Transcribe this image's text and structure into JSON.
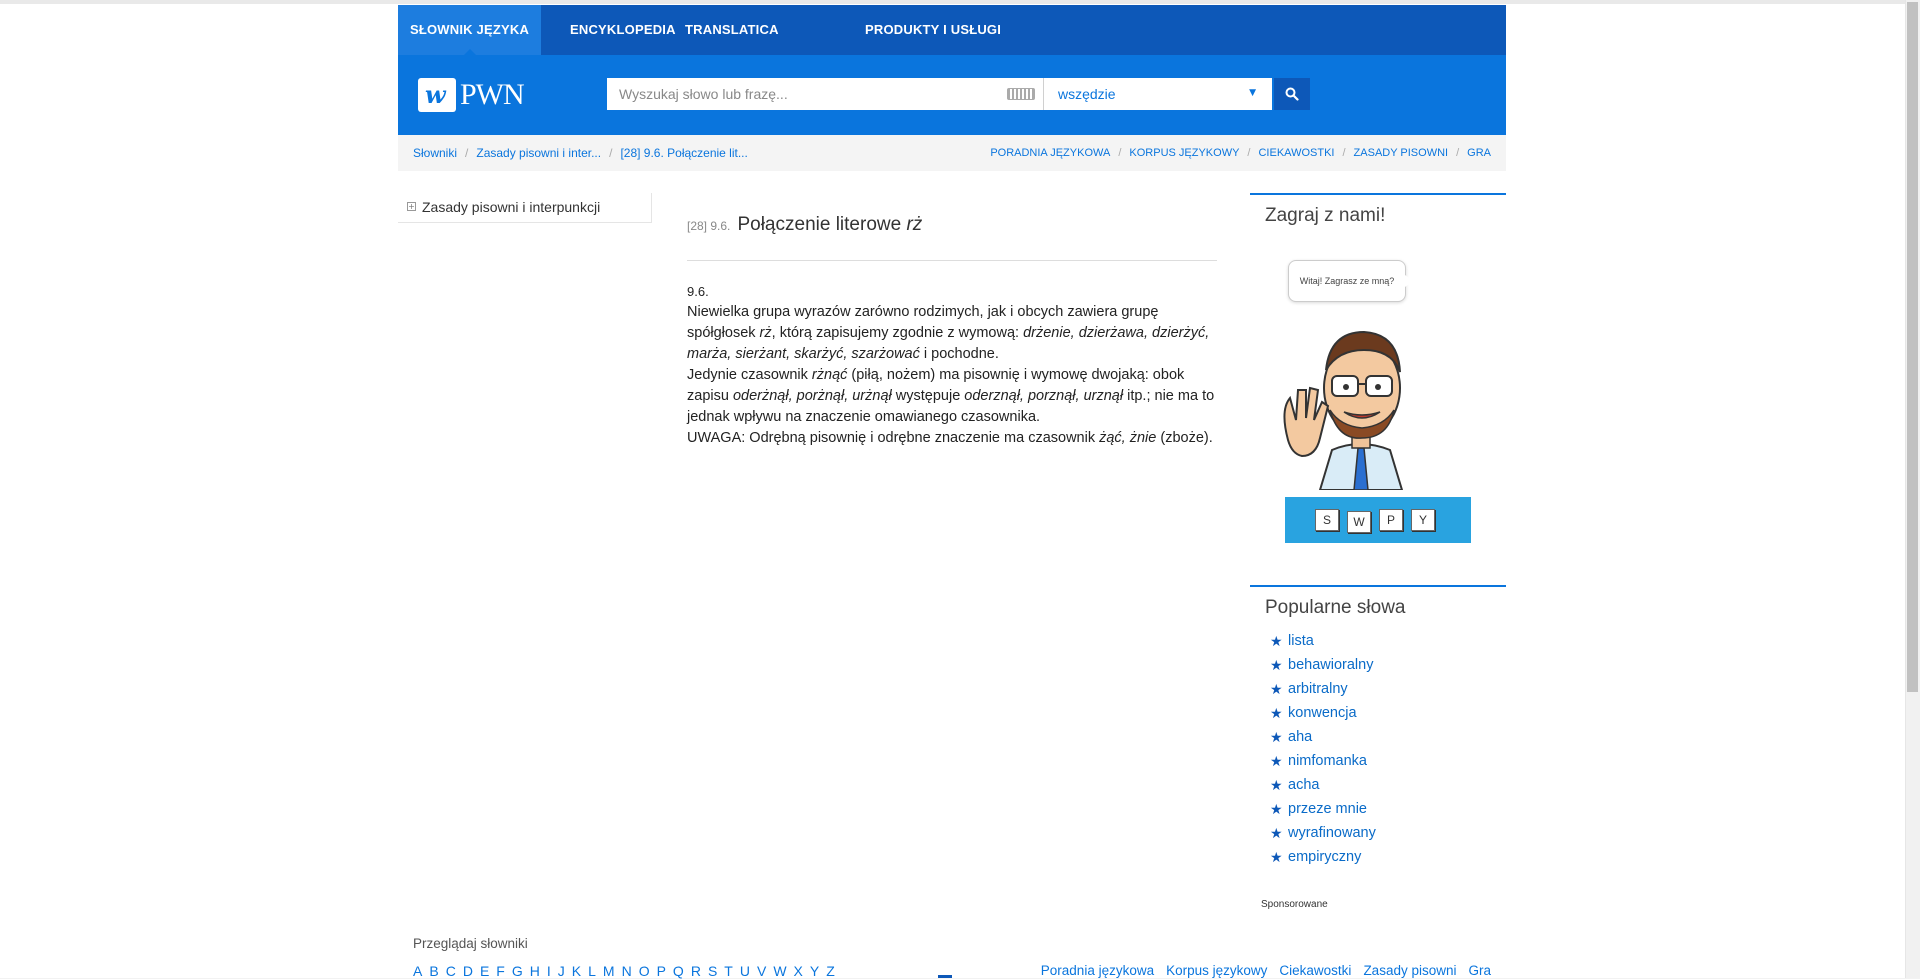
{
  "nav": {
    "items": [
      "SŁOWNIK JĘZYKA POLSKIEGO",
      "ENCYKLOPEDIA",
      "TRANSLATICA",
      "PRODUKTY I USŁUGI"
    ]
  },
  "header": {
    "logo_text": "PWN",
    "search_placeholder": "Wyszukaj słowo lub frazę...",
    "scope_value": "wszędzie"
  },
  "breadcrumb": {
    "items": [
      "Słowniki",
      "Zasady pisowni i inter...",
      "[28] 9.6. Połączenie lit..."
    ]
  },
  "sublinks": [
    "PORADNIA JĘZYKOWA",
    "KORPUS JĘZYKOWY",
    "CIEKAWOSTKI",
    "ZASADY PISOWNI",
    "GRA"
  ],
  "tree": {
    "label": "Zasady pisowni i interpunkcji",
    "toggle": "+"
  },
  "article": {
    "number": "[28] 9.6.",
    "title_main": "Połączenie literowe ",
    "title_italic": "rż",
    "section": "9.6.",
    "p1_a": "Niewielka grupa wyrazów zarówno rodzimych, jak i obcych zawiera grupę spółgłosek ",
    "p1_b": "rż",
    "p1_c": ", którą zapisujemy zgodnie z wymową: ",
    "p1_d": "drżenie, dzierżawa, dzierżyć, marża, sierżant, skarżyć, szarżować",
    "p1_e": " i pochodne.",
    "p2_a": "Jedynie czasownik ",
    "p2_b": "rżnąć",
    "p2_c": " (piłą, nożem) ma pisownię i wymowę dwojaką: obok zapisu ",
    "p2_d": "oderżnął, porżnął, urżnął",
    "p2_e": " występuje ",
    "p2_f": "oderznął, porznął, urznął",
    "p2_g": " itp.; nie ma to jednak wpływu na znaczenie omawianego czasownika.",
    "p3_a": "UWAGA: Odrębną pisownię i odrębne znaczenie ma czasownik ",
    "p3_b": "żąć, żnie",
    "p3_c": " (zboże)."
  },
  "game": {
    "title": "Zagraj z nami!",
    "bubble": "Witaj! Zagrasz ze mną?",
    "tiles": [
      "S",
      "W",
      "P",
      "Y"
    ]
  },
  "popular": {
    "title": "Popularne słowa",
    "items": [
      "lista",
      "behawioralny",
      "arbitralny",
      "konwencja",
      "aha",
      "nimfomanka",
      "acha",
      "przeze mnie",
      "wyrafinowany",
      "empiryczny"
    ]
  },
  "sponsored": "Sponsorowane",
  "footer": {
    "browse_label": "Przeglądaj słowniki",
    "letters": [
      "A",
      "B",
      "C",
      "D",
      "E",
      "F",
      "G",
      "H",
      "I",
      "J",
      "K",
      "L",
      "M",
      "N",
      "O",
      "P",
      "Q",
      "R",
      "S",
      "T",
      "U",
      "V",
      "W",
      "X",
      "Y",
      "Z"
    ],
    "links": [
      "Poradnia językowa",
      "Korpus językowy",
      "Ciekawostki",
      "Zasady pisowni",
      "Gra"
    ]
  }
}
